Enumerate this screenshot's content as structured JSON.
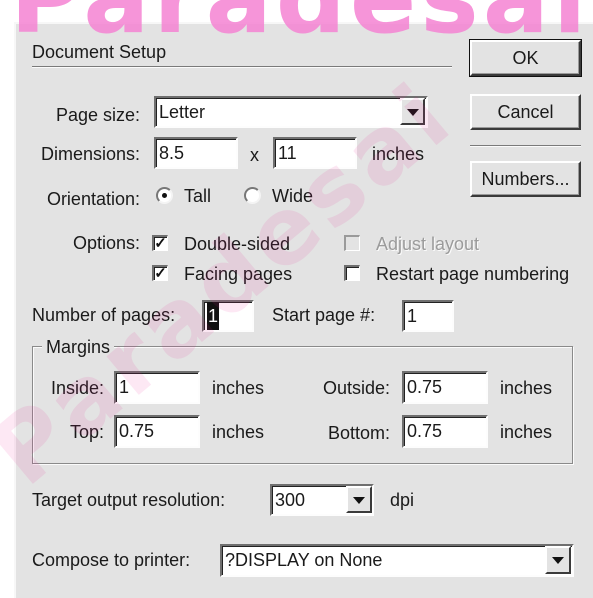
{
  "dialog": {
    "title": "Document Setup"
  },
  "buttons": {
    "ok": "OK",
    "cancel": "Cancel",
    "numbers": "Numbers..."
  },
  "page_size": {
    "label": "Page size:",
    "value": "Letter"
  },
  "dimensions": {
    "label": "Dimensions:",
    "width": "8.5",
    "separator": "x",
    "height": "11",
    "unit": "inches"
  },
  "orientation": {
    "label": "Orientation:",
    "tall": "Tall",
    "wide": "Wide",
    "selected": "Tall"
  },
  "options": {
    "label": "Options:",
    "double_sided": {
      "label": "Double-sided",
      "checked": true
    },
    "facing_pages": {
      "label": "Facing pages",
      "checked": true
    },
    "adjust_layout": {
      "label": "Adjust layout",
      "checked": false,
      "disabled": true
    },
    "restart_numbering": {
      "label": "Restart page numbering",
      "checked": false
    }
  },
  "pages": {
    "label": "Number of pages:",
    "value": "1",
    "start_label": "Start page #:",
    "start_value": "1"
  },
  "margins": {
    "legend": "Margins",
    "inside_label": "Inside:",
    "inside_value": "1",
    "outside_label": "Outside:",
    "outside_value": "0.75",
    "top_label": "Top:",
    "top_value": "0.75",
    "bottom_label": "Bottom:",
    "bottom_value": "0.75",
    "unit": "inches"
  },
  "resolution": {
    "label": "Target output resolution:",
    "value": "300",
    "unit": "dpi"
  },
  "printer": {
    "label": "Compose to printer:",
    "value": "?DISPLAY on None"
  },
  "watermark": {
    "top": "Paradesai",
    "diagonal": "Paradesai"
  },
  "icons": {
    "dropdown": "chevron-down-icon",
    "check": "checkmark-icon"
  }
}
